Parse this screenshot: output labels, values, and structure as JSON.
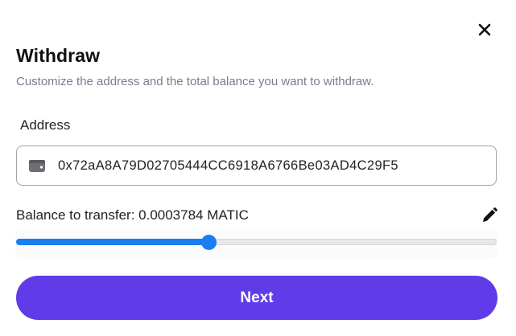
{
  "dialog": {
    "title": "Withdraw",
    "subtitle": "Customize the address and the total balance you want to withdraw.",
    "close_icon": "close-icon"
  },
  "address": {
    "label": "Address",
    "value": "0x72aA8A79D02705444CC6918A6766Be03AD4C29F5",
    "icon": "wallet-icon"
  },
  "balance": {
    "label": "Balance to transfer: 0.0003784 MATIC",
    "edit_icon": "pencil-icon",
    "slider_fraction": 0.4
  },
  "actions": {
    "next_label": "Next"
  },
  "colors": {
    "accent": "#5f3ce8",
    "slider": "#1a7df0",
    "muted_text": "#787c8f"
  }
}
